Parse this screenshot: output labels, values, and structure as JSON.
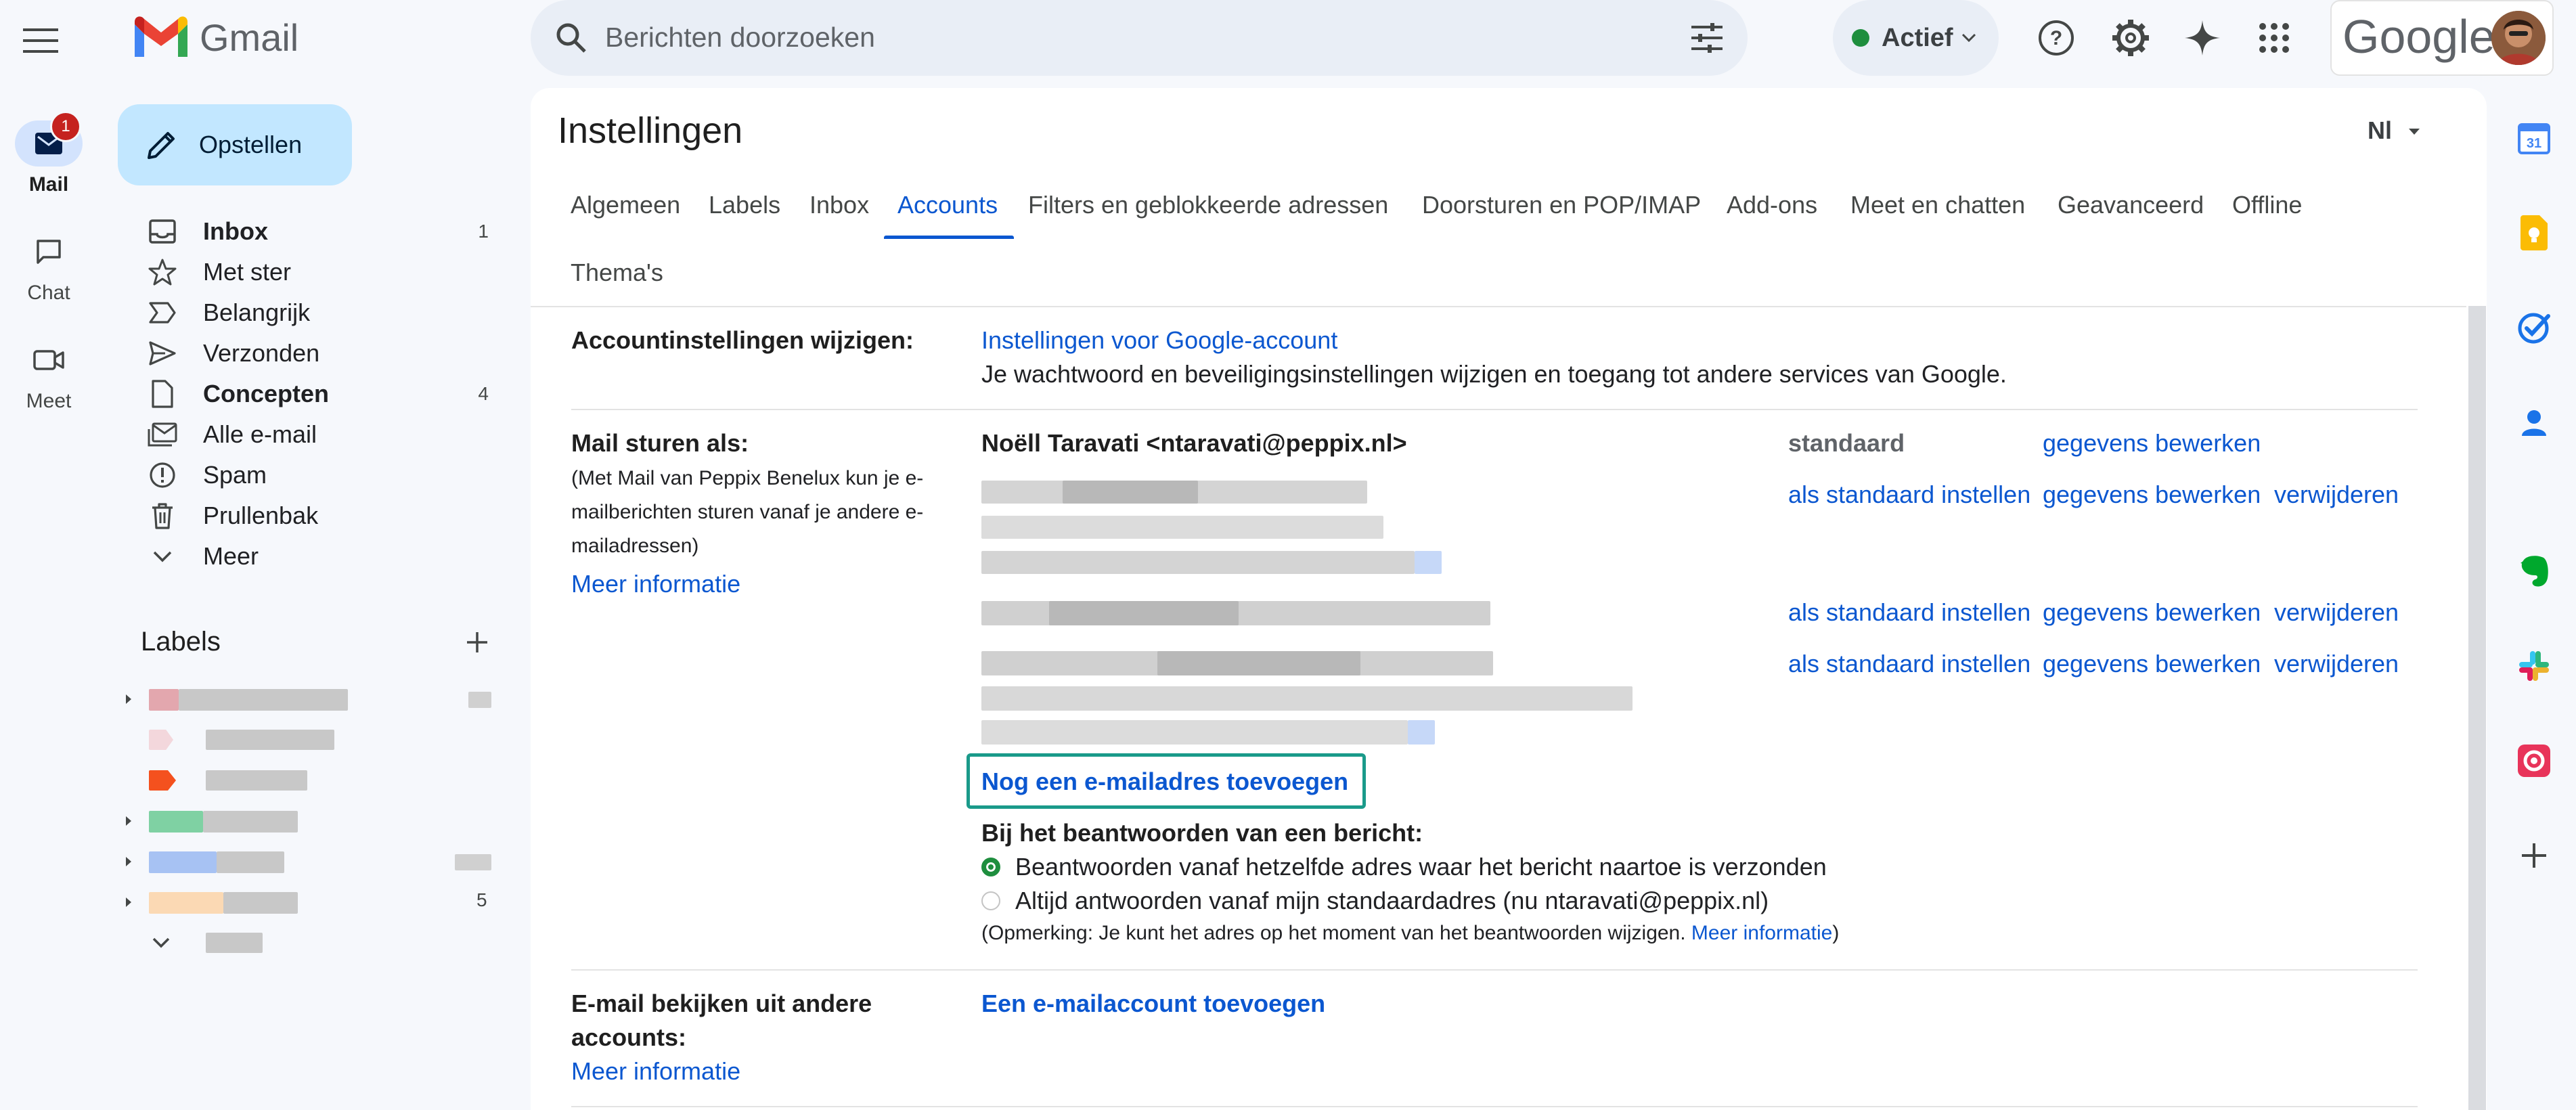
{
  "app": {
    "name": "Gmail",
    "brand_colors": {
      "blue": "#4285f4",
      "red": "#ea4335",
      "yellow": "#fbbc04",
      "green": "#34a853"
    }
  },
  "search": {
    "placeholder": "Berichten doorzoeken"
  },
  "status": {
    "label": "Actief",
    "color": "#1e8e3e"
  },
  "account_logo": "Google",
  "rail": [
    {
      "label": "Mail",
      "icon": "mail-icon",
      "badge": "1"
    },
    {
      "label": "Chat",
      "icon": "chat-icon"
    },
    {
      "label": "Meet",
      "icon": "meet-icon"
    }
  ],
  "compose": {
    "label": "Opstellen"
  },
  "nav": [
    {
      "label": "Inbox",
      "icon": "inbox-icon",
      "count": "1",
      "bold": true
    },
    {
      "label": "Met ster",
      "icon": "star-icon"
    },
    {
      "label": "Belangrijk",
      "icon": "important-icon"
    },
    {
      "label": "Verzonden",
      "icon": "send-icon"
    },
    {
      "label": "Concepten",
      "icon": "draft-icon",
      "count": "4",
      "bold": true
    },
    {
      "label": "Alle e-mail",
      "icon": "all-mail-icon"
    },
    {
      "label": "Spam",
      "icon": "spam-icon"
    },
    {
      "label": "Prullenbak",
      "icon": "trash-icon"
    },
    {
      "label": "Meer",
      "icon": "chevron-down-icon"
    }
  ],
  "labels": {
    "heading": "Labels",
    "item_count": "5"
  },
  "settings": {
    "title": "Instellingen",
    "lang_short": "Nl",
    "tabs": [
      "Algemeen",
      "Labels",
      "Inbox",
      "Accounts",
      "Filters en geblokkeerde adressen",
      "Doorsturen en POP/IMAP",
      "Add-ons",
      "Meet en chatten",
      "Geavanceerd",
      "Offline",
      "Thema's"
    ],
    "active_tab": "Accounts",
    "account_settings": {
      "label": "Accountinstellingen wijzigen:",
      "link": "Instellingen voor Google-account",
      "desc": "Je wachtwoord en beveiligingsinstellingen wijzigen en toegang tot andere services van Google."
    },
    "send_as": {
      "label": "Mail sturen als:",
      "desc_lines": [
        "(Met Mail van Peppix Benelux kun je e-",
        "mailberichten sturen vanaf je andere e-",
        "mailadressen)"
      ],
      "more_info": "Meer informatie",
      "primary": "Noëll Taravati <ntaravati@peppix.nl>",
      "default_label": "standaard",
      "edit": "gegevens bewerken",
      "make_default": "als standaard instellen",
      "remove": "verwijderen",
      "add_address": "Nog een e-mailadres toevoegen"
    },
    "reply": {
      "heading": "Bij het beantwoorden van een bericht:",
      "option1": "Beantwoorden vanaf hetzelfde adres waar het bericht naartoe is verzonden",
      "option2": "Altijd antwoorden vanaf mijn standaardadres (nu ntaravati@peppix.nl)",
      "note_prefix": "(Opmerking: Je kunt het adres op het moment van het beantwoorden wijzigen. ",
      "note_link": "Meer informatie",
      "note_suffix": ")",
      "selected": 1
    },
    "check_mail": {
      "label_line1": "E-mail bekijken uit andere",
      "label_line2": "accounts:",
      "more_info": "Meer informatie",
      "link": "Een e-mailaccount toevoegen"
    }
  }
}
